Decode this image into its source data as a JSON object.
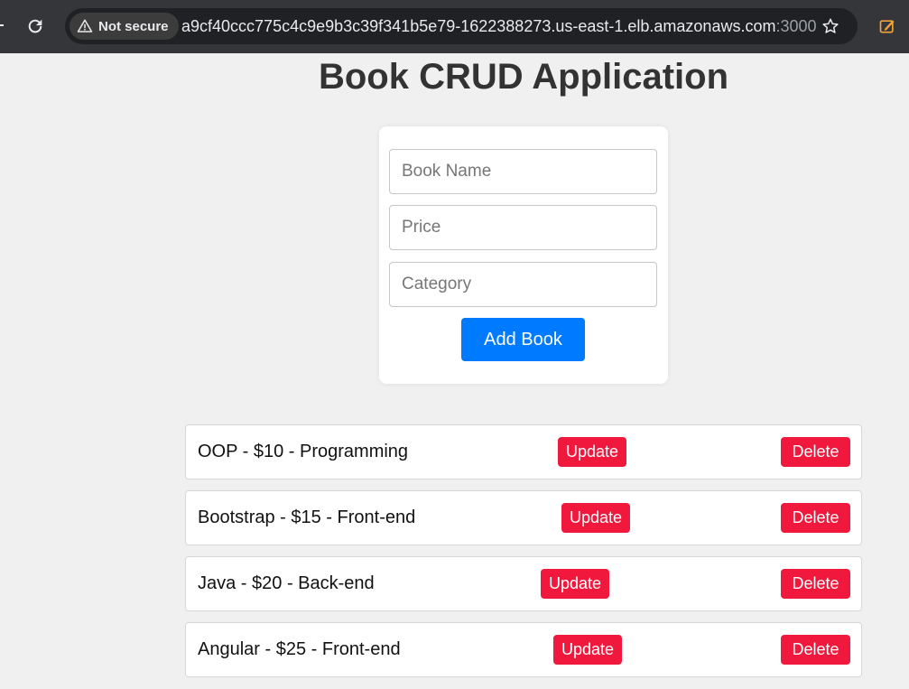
{
  "browser": {
    "security_label": "Not secure",
    "url_host": "a9cf40ccc775c4c9e9b3c39f341b5e79-1622388273.us-east-1.elb.amazonaws.com",
    "url_port": ":3000"
  },
  "page": {
    "title": "Book CRUD Application"
  },
  "form": {
    "book_name_placeholder": "Book Name",
    "price_placeholder": "Price",
    "category_placeholder": "Category",
    "add_label": "Add Book"
  },
  "books": [
    {
      "text": "OOP - $10 - Programming",
      "update_label": "Update",
      "delete_label": "Delete"
    },
    {
      "text": "Bootstrap - $15 - Front-end",
      "update_label": "Update",
      "delete_label": "Delete"
    },
    {
      "text": "Java - $20 - Back-end",
      "update_label": "Update",
      "delete_label": "Delete"
    },
    {
      "text": "Angular - $25 - Front-end",
      "update_label": "Update",
      "delete_label": "Delete"
    }
  ],
  "colors": {
    "primary": "#007bff",
    "danger": "#f0193d",
    "page_background": "#f0f0f0"
  }
}
